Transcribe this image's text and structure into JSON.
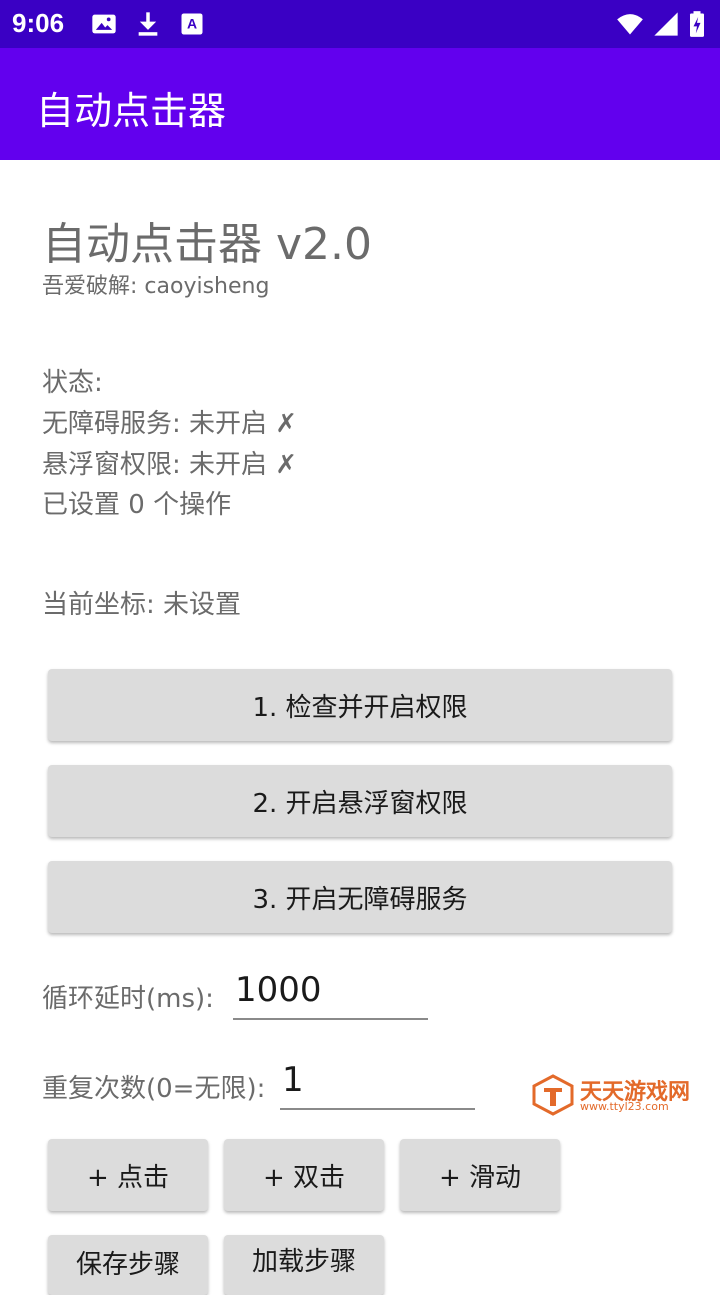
{
  "status_bar": {
    "time": "9:06",
    "icons": [
      "image-icon",
      "download-icon",
      "font-icon",
      "wifi-icon",
      "signal-icon",
      "battery-icon"
    ]
  },
  "app_bar": {
    "title": "自动点击器"
  },
  "main": {
    "title": "自动点击器 v2.0",
    "subtitle": "吾爱破解: caoyisheng",
    "status_header": "状态:",
    "accessibility_status": "无障碍服务: 未开启 ✗",
    "overlay_status": "悬浮窗权限: 未开启 ✗",
    "ops_count": "已设置 0 个操作",
    "current_coord": "当前坐标: 未设置"
  },
  "buttons": {
    "check_permissions": "1. 检查并开启权限",
    "overlay_permission": "2. 开启悬浮窗权限",
    "accessibility_service": "3. 开启无障碍服务",
    "add_click": "+ 点击",
    "add_double_click": "+ 双击",
    "add_swipe": "+ 滑动",
    "save_steps": "保存步骤",
    "load_steps": "加载步骤"
  },
  "fields": {
    "loop_delay_label": "循环延时(ms):",
    "loop_delay_value": "1000",
    "repeat_label": "重复次数(0=无限):",
    "repeat_value": "1"
  },
  "watermark": {
    "text": "天天游戏网",
    "url": "www.ttyl23.com"
  },
  "colors": {
    "status_bar": "#3a00c4",
    "app_bar": "#6200ee",
    "button": "#dcdcdc",
    "watermark": "#e36a2a"
  }
}
